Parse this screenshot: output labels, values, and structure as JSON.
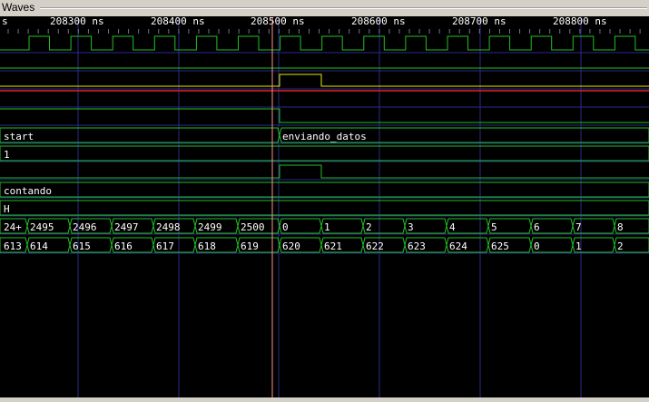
{
  "panel_title": "Waves",
  "ruler": {
    "left_fragment": "s",
    "labels": [
      "208300 ns",
      "208400 ns",
      "208500 ns",
      "208600 ns",
      "208700 ns",
      "208800 ns"
    ]
  },
  "colors": {
    "wave": "#22c022",
    "grid": "#2a2a8c",
    "cursor": "#ff9090",
    "yellow": "#e8e800",
    "red": "#e02020"
  },
  "signals": {
    "state": [
      "start",
      "enviando_datos"
    ],
    "row_1": [
      "1"
    ],
    "mode": [
      "contando"
    ],
    "row_h": [
      "H"
    ],
    "counter": [
      "24+",
      "2495",
      "2496",
      "2497",
      "2498",
      "2499",
      "2500",
      "0",
      "1",
      "2",
      "3",
      "4",
      "5",
      "6",
      "7",
      "8"
    ],
    "index": [
      "613",
      "614",
      "615",
      "616",
      "617",
      "618",
      "619",
      "620",
      "621",
      "622",
      "623",
      "624",
      "625",
      "0",
      "1",
      "2"
    ]
  }
}
